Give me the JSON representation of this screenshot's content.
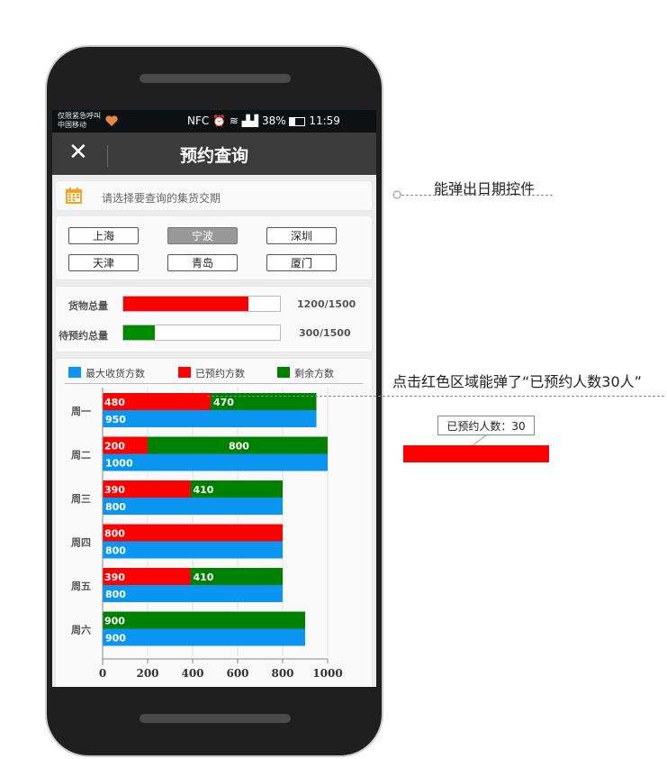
{
  "status_bar": {
    "carrier_line1": "仅限紧急呼叫",
    "carrier_line2": "中国移动",
    "icons": "NFC ⏰ ≋ ▟▟",
    "battery": "38%",
    "time": "11:59"
  },
  "header": {
    "title": "预约查询",
    "close_icon": "close-icon"
  },
  "date_picker": {
    "placeholder": "请选择要查询的集货交期"
  },
  "cities": [
    {
      "label": "上海",
      "selected": false
    },
    {
      "label": "宁波",
      "selected": true
    },
    {
      "label": "深圳",
      "selected": false
    },
    {
      "label": "天津",
      "selected": false
    },
    {
      "label": "青岛",
      "selected": false
    },
    {
      "label": "厦门",
      "selected": false
    }
  ],
  "progress": [
    {
      "label": "货物总量",
      "value": 1200,
      "max": 1500,
      "text": "1200/1500",
      "color": "#ff0000"
    },
    {
      "label": "待预约总量",
      "value": 300,
      "max": 1500,
      "text": "300/1500",
      "color": "#008c00"
    }
  ],
  "chart_data": {
    "type": "bar",
    "orientation": "horizontal",
    "categories": [
      "周一",
      "周二",
      "周三",
      "周四",
      "周五",
      "周六"
    ],
    "series": [
      {
        "name": "最大收货方数",
        "color": "#0a96f0",
        "values": [
          950,
          1000,
          800,
          800,
          800,
          900
        ]
      },
      {
        "name": "已预约方数",
        "color": "#ff0000",
        "values": [
          480,
          200,
          390,
          800,
          390,
          0
        ]
      },
      {
        "name": "剩余方数",
        "color": "#008000",
        "values": [
          470,
          800,
          410,
          0,
          410,
          900
        ]
      }
    ],
    "stacked": [
      "已预约方数",
      "剩余方数"
    ],
    "xlim": [
      0,
      1000
    ],
    "xticks": [
      "0",
      "200",
      "400",
      "600",
      "800",
      "1000"
    ],
    "grid": true,
    "legend_position": "top"
  },
  "annotations": {
    "date_note": "能弹出日期控件",
    "click_note": "点击红色区域能弹了“已预约人数30人”",
    "tooltip_text": "已预约人数：30"
  }
}
